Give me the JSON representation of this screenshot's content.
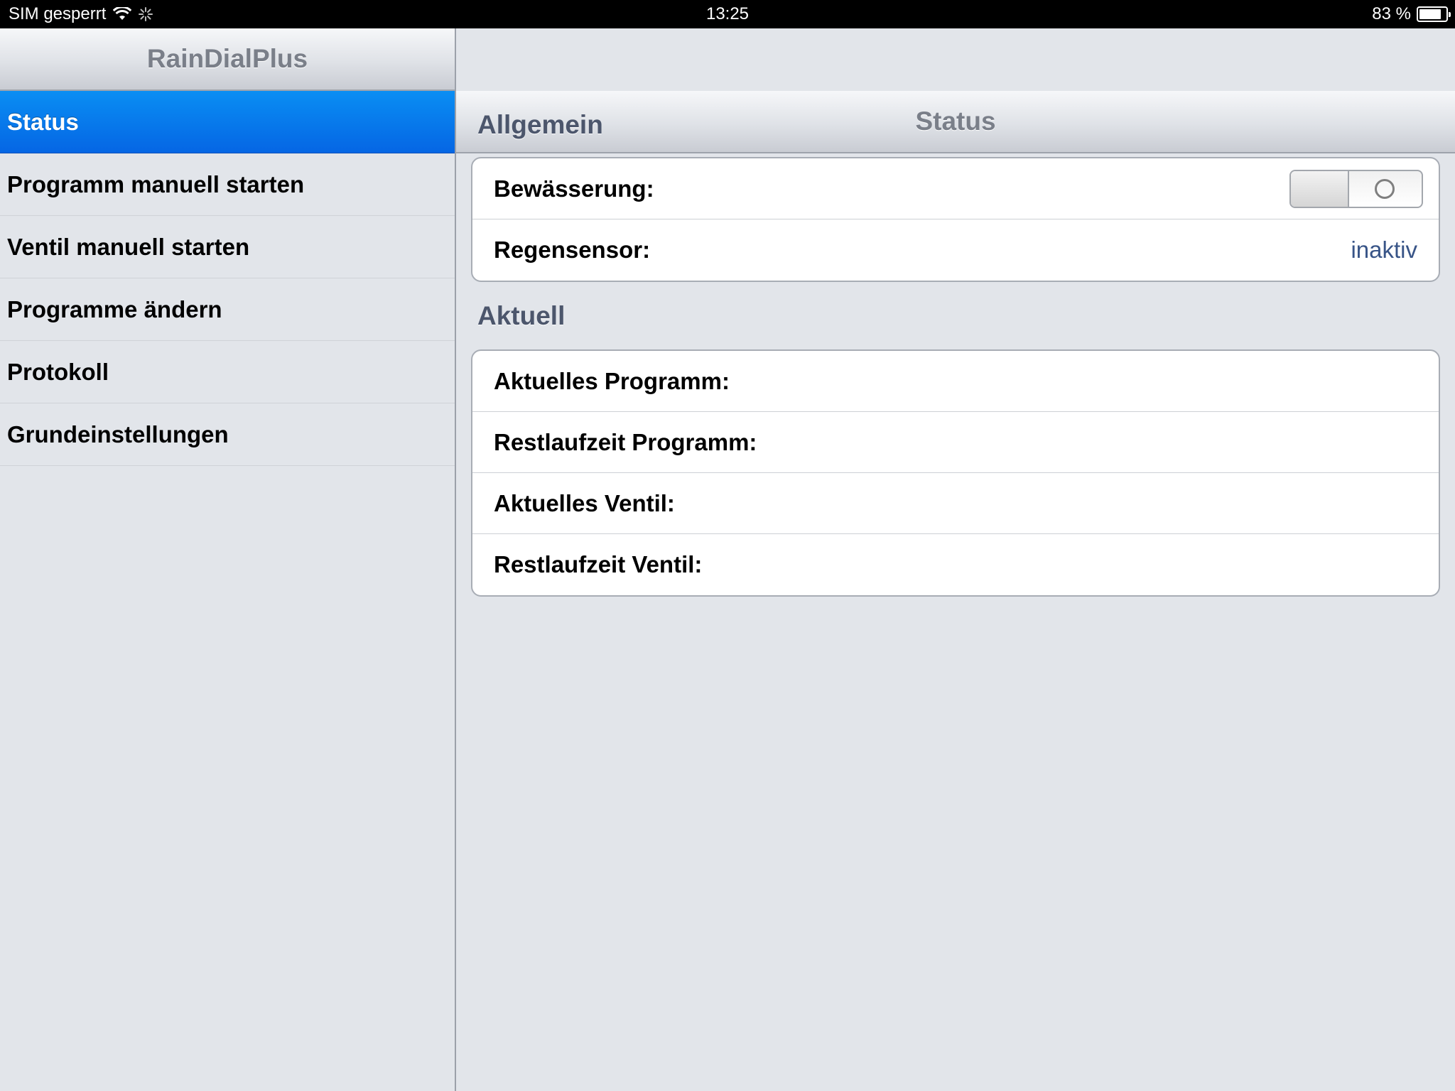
{
  "status_bar": {
    "carrier": "SIM gesperrt",
    "time": "13:25",
    "battery_text": "83 %",
    "battery_level": 0.83,
    "wifi_icon": "wifi-icon",
    "activity_icon": "activity-spinner-icon"
  },
  "master": {
    "title": "RainDialPlus",
    "items": [
      {
        "label": "Status",
        "selected": true
      },
      {
        "label": "Programm manuell starten"
      },
      {
        "label": "Ventil manuell starten"
      },
      {
        "label": "Programme ändern"
      },
      {
        "label": "Protokoll"
      },
      {
        "label": "Grundeinstellungen"
      }
    ]
  },
  "detail": {
    "title": "Status",
    "sections": {
      "allgemein": {
        "header": "Allgemein",
        "rows": {
          "bewaesserung": {
            "label": "Bewässerung:",
            "switch_on": false
          },
          "regensensor": {
            "label": "Regensensor:",
            "value": "inaktiv"
          }
        }
      },
      "aktuell": {
        "header": "Aktuell",
        "rows": [
          {
            "label": "Aktuelles Programm:"
          },
          {
            "label": "Restlaufzeit Programm:"
          },
          {
            "label": "Aktuelles Ventil:"
          },
          {
            "label": "Restlaufzeit Ventil:"
          }
        ]
      }
    }
  },
  "colors": {
    "selection_blue": "#0566e4",
    "value_blue": "#385487",
    "section_header": "#4c566c",
    "background": "#e2e5ea"
  }
}
